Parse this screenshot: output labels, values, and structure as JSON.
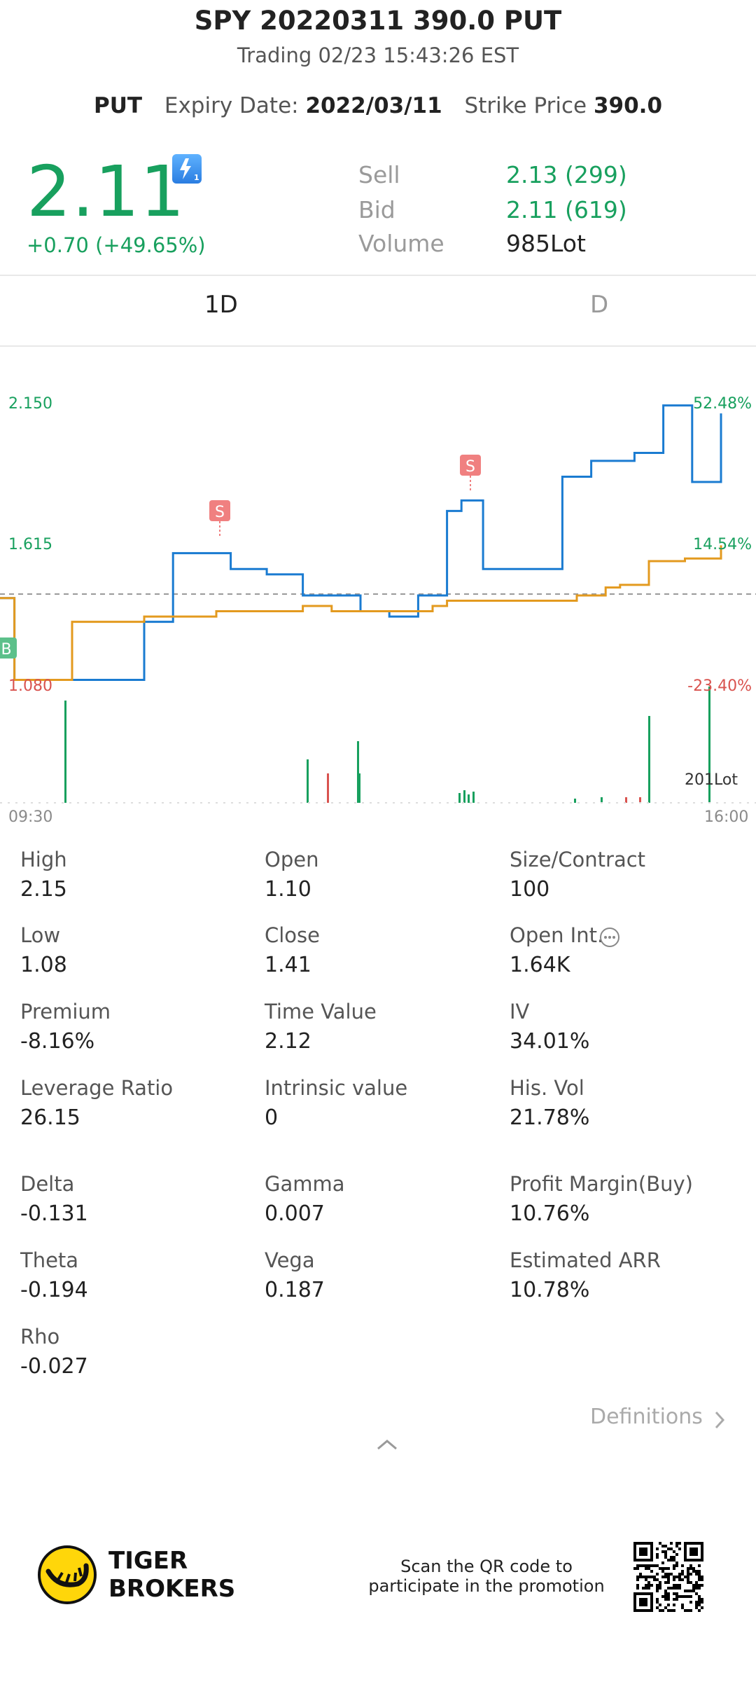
{
  "header": {
    "title": "SPY 20220311 390.0 PUT",
    "subtitle": "Trading 02/23 15:43:26 EST",
    "type": "PUT",
    "expiry_label": "Expiry Date:",
    "expiry_value": "2022/03/11",
    "strike_label": "Strike Price",
    "strike_value": "390.0"
  },
  "quote": {
    "price": "2.11",
    "change": "+0.70 (+49.65%)",
    "sell_label": "Sell",
    "sell_value": "2.13 (299)",
    "bid_label": "Bid",
    "bid_value": "2.11 (619)",
    "volume_label": "Volume",
    "volume_value": "985Lot"
  },
  "tabs": [
    {
      "label": "1D",
      "active": true
    },
    {
      "label": "D",
      "active": false
    }
  ],
  "chart": {
    "left_labels": {
      "top": "2.150",
      "mid": "1.615",
      "bottom": "1.080"
    },
    "right_labels": {
      "top": "52.48%",
      "mid": "14.54%",
      "bottom": "-23.40%"
    },
    "volume_label": "201Lot",
    "time_start": "09:30",
    "time_end": "16:00",
    "markers": {
      "sell": "S",
      "buy": "B"
    }
  },
  "chart_data": {
    "type": "line",
    "x_start": "09:30",
    "x_end": "16:00",
    "ylim": [
      1.08,
      2.15
    ],
    "y_right_lim": [
      "-23.40%",
      "52.48%"
    ],
    "reference_close": 1.41,
    "series": [
      {
        "color": "#1a7bd1",
        "x": [
          0,
          2,
          12,
          20,
          24,
          27,
          32,
          37,
          42,
          45,
          50,
          54,
          58,
          62,
          64,
          67,
          70,
          74,
          78,
          82,
          85,
          88,
          92,
          96,
          100
        ],
        "values": [
          1.41,
          1.1,
          1.1,
          1.32,
          1.58,
          1.58,
          1.52,
          1.5,
          1.42,
          1.42,
          1.36,
          1.34,
          1.42,
          1.74,
          1.78,
          1.52,
          1.52,
          1.52,
          1.87,
          1.93,
          1.93,
          1.96,
          2.14,
          1.85,
          2.11
        ]
      },
      {
        "color": "#e39a1f",
        "x": [
          0,
          2,
          8,
          10,
          20,
          30,
          42,
          46,
          60,
          62,
          80,
          84,
          86,
          90,
          95,
          100
        ],
        "values": [
          1.41,
          1.1,
          1.1,
          1.32,
          1.34,
          1.36,
          1.38,
          1.36,
          1.38,
          1.4,
          1.42,
          1.45,
          1.46,
          1.55,
          1.56,
          1.61
        ]
      }
    ],
    "volume_max_label": "201Lot"
  },
  "stats": [
    {
      "label": "High",
      "value": "2.15"
    },
    {
      "label": "Open",
      "value": "1.10"
    },
    {
      "label": "Size/Contract",
      "value": "100"
    },
    {
      "label": "Low",
      "value": "1.08"
    },
    {
      "label": "Close",
      "value": "1.41"
    },
    {
      "label": "Open Int.",
      "value": "1.64K"
    },
    {
      "label": "Premium",
      "value": "-8.16%"
    },
    {
      "label": "Time Value",
      "value": "2.12"
    },
    {
      "label": "IV",
      "value": "34.01%"
    },
    {
      "label": "Leverage Ratio",
      "value": "26.15"
    },
    {
      "label": "Intrinsic value",
      "value": "0"
    },
    {
      "label": "His. Vol",
      "value": "21.78%"
    },
    {
      "label": "Delta",
      "value": "-0.131"
    },
    {
      "label": "Gamma",
      "value": "0.007"
    },
    {
      "label": "Profit Margin(Buy)",
      "value": "10.76%"
    },
    {
      "label": "Theta",
      "value": "-0.194"
    },
    {
      "label": "Vega",
      "value": "0.187"
    },
    {
      "label": "Estimated ARR",
      "value": "10.78%"
    },
    {
      "label": "Rho",
      "value": "-0.027"
    }
  ],
  "definitions_label": "Definitions",
  "footer": {
    "brand_line1": "TIGER",
    "brand_line2": "BROKERS",
    "promo_line1": "Scan the QR code to",
    "promo_line2": "participate in the promotion"
  },
  "colors": {
    "green": "#18a05e",
    "red": "#d9534f",
    "blue_line": "#1a7bd1",
    "orange_line": "#e39a1f"
  }
}
